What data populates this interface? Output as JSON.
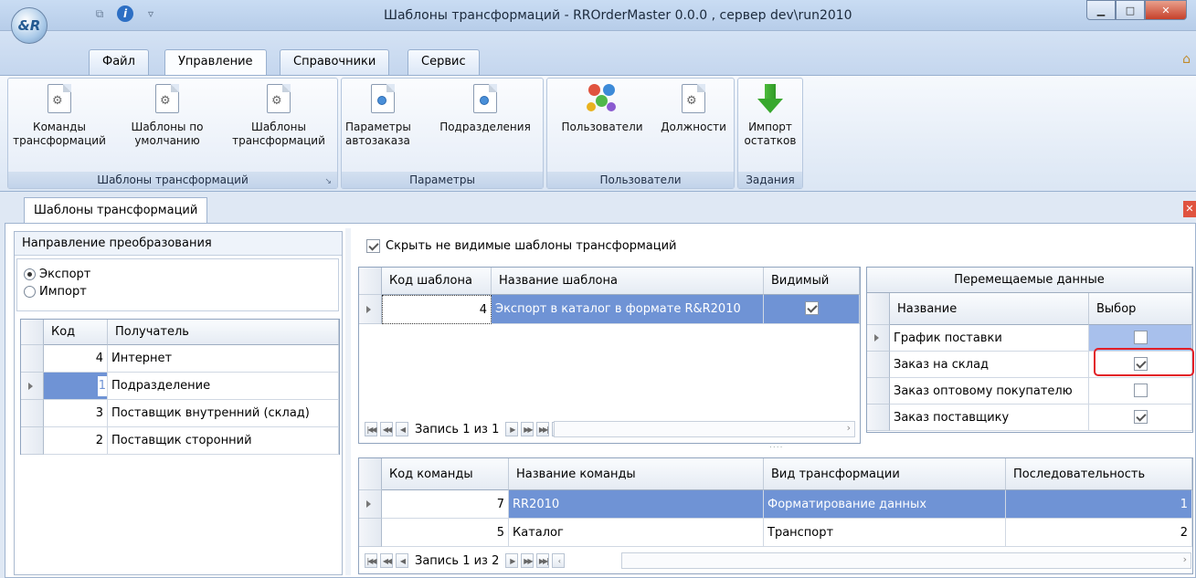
{
  "window": {
    "title": "Шаблоны трансформаций - RROrderMaster 0.0.0 , сервер dev\\run2010",
    "logo": "&R"
  },
  "ribbon_tabs": [
    "Файл",
    "Управление",
    "Справочники",
    "Сервис"
  ],
  "groups": [
    {
      "label": "Шаблоны трансформаций",
      "buttons": [
        "Команды\nтрансформаций",
        "Шаблоны по\nумолчанию",
        "Шаблоны\nтрансформаций"
      ]
    },
    {
      "label": "Параметры",
      "buttons": [
        "Параметры\nавтозаказа",
        "Подразделения"
      ]
    },
    {
      "label": "Пользователи",
      "buttons": [
        "Пользователи",
        "Должности"
      ]
    },
    {
      "label": "Задания",
      "buttons": [
        "Импорт\nостатков"
      ]
    }
  ],
  "doc_tab": "Шаблоны трансформаций",
  "direction": {
    "title": "Направление преобразования",
    "options": [
      "Экспорт",
      "Импорт"
    ],
    "selected": "Экспорт"
  },
  "recipients": {
    "headers": [
      "Код",
      "Получатель"
    ],
    "rows": [
      [
        "4",
        "Интернет"
      ],
      [
        "1",
        "Подразделение"
      ],
      [
        "3",
        "Поставщик внутренний (склад)"
      ],
      [
        "2",
        "Поставщик сторонний"
      ]
    ]
  },
  "hide_invisible": {
    "label": "Скрыть не видимые шаблоны трансформаций",
    "checked": true
  },
  "templates": {
    "headers": [
      "Код шаблона",
      "Название шаблона",
      "Видимый"
    ],
    "rows": [
      [
        "4",
        "Экспорт в каталог в формате  R&R2010"
      ]
    ],
    "nav": "Запись 1 из 1"
  },
  "moved_data": {
    "title": "Перемещаемые данные",
    "headers": [
      "Название",
      "Выбор"
    ],
    "rows": [
      [
        "График поставки",
        false
      ],
      [
        "Заказ на склад",
        true
      ],
      [
        "Заказ оптовому покупателю",
        false
      ],
      [
        "Заказ поставщику",
        true
      ]
    ]
  },
  "commands": {
    "headers": [
      "Код команды",
      "Название команды",
      "Вид трансформации",
      "Последовательность"
    ],
    "rows": [
      [
        "7",
        "RR2010",
        "Форматирование данных",
        "1"
      ],
      [
        "5",
        "Каталог",
        "Транспорт",
        "2"
      ]
    ],
    "nav": "Запись 1 из 2"
  }
}
